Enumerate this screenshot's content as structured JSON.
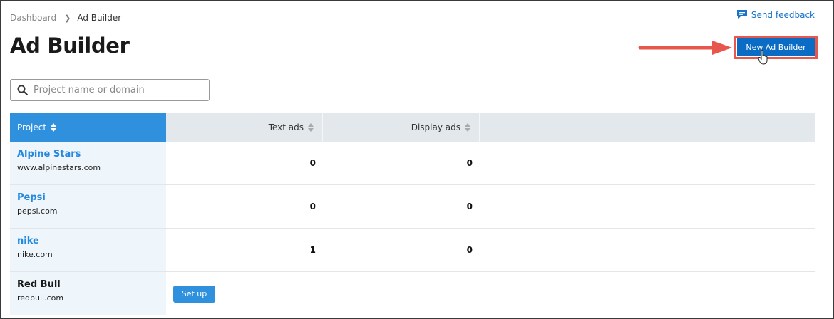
{
  "breadcrumb": {
    "home": "Dashboard",
    "current": "Ad Builder"
  },
  "page_title": "Ad Builder",
  "feedback": {
    "label": "Send feedback",
    "icon": "chat-icon"
  },
  "new_button": {
    "label": "New Ad Builder"
  },
  "search": {
    "placeholder": "Project name or domain",
    "value": ""
  },
  "table": {
    "headers": {
      "project": "Project",
      "text_ads": "Text ads",
      "display_ads": "Display ads"
    },
    "rows": [
      {
        "name": "Alpine Stars",
        "domain": "www.alpinestars.com",
        "text_ads": "0",
        "display_ads": "0"
      },
      {
        "name": "Pepsi",
        "domain": "pepsi.com",
        "text_ads": "0",
        "display_ads": "0"
      },
      {
        "name": "nike",
        "domain": "nike.com",
        "text_ads": "1",
        "display_ads": "0"
      },
      {
        "name": "Red Bull",
        "domain": "redbull.com",
        "setup_label": "Set up"
      }
    ]
  },
  "colors": {
    "accent": "#2f91dd",
    "primary_button": "#0b6cc6",
    "highlight": "#e8574c",
    "link": "#2389dd"
  }
}
